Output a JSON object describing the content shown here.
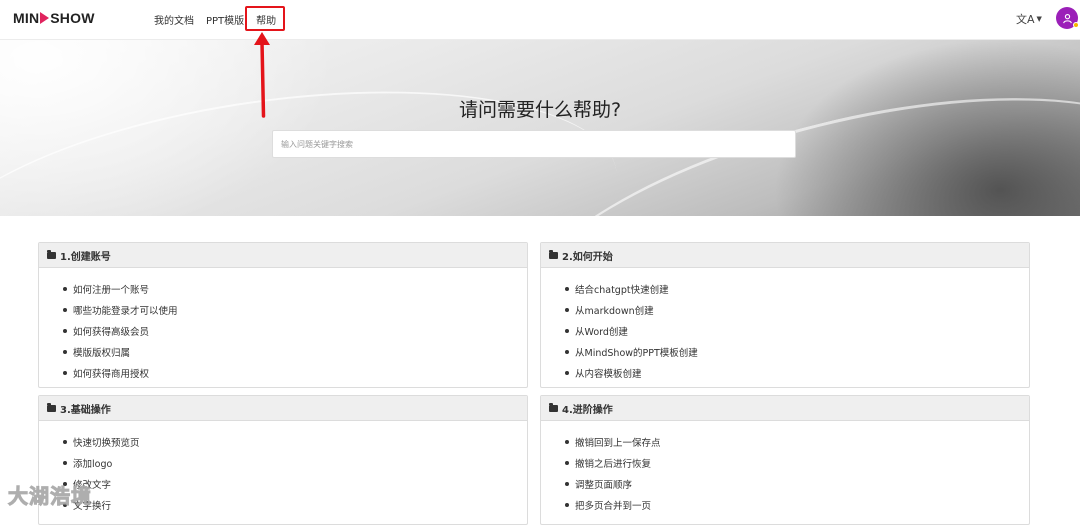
{
  "header": {
    "logo_left": "MIN",
    "logo_right": "SHOW",
    "nav": [
      {
        "label": "我的文档"
      },
      {
        "label": "PPT模版"
      },
      {
        "label": "帮助"
      }
    ],
    "lang_icon": "文A",
    "avatar_icon": "user-icon"
  },
  "hero": {
    "title": "请问需要什么帮助?",
    "search_placeholder": "输入问题关键字搜索"
  },
  "sections": [
    {
      "title": "1.创建账号",
      "items": [
        "如何注册一个账号",
        "哪些功能登录才可以使用",
        "如何获得高级会员",
        "模版版权归属",
        "如何获得商用授权"
      ]
    },
    {
      "title": "2.如何开始",
      "items": [
        "结合chatgpt快速创建",
        "从markdown创建",
        "从Word创建",
        "从MindShow的PPT模板创建",
        "从内容模板创建"
      ]
    },
    {
      "title": "3.基础操作",
      "items": [
        "快速切换预览页",
        "添加logo",
        "修改文字",
        "文字换行"
      ]
    },
    {
      "title": "4.进阶操作",
      "items": [
        "撤销回到上一保存点",
        "撤销之后进行恢复",
        "调整页面顺序",
        "把多页合并到一页"
      ]
    }
  ],
  "annotation": {
    "highlight_color": "#e4141a"
  },
  "watermark": "大湖浩境"
}
